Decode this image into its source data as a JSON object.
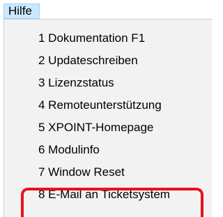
{
  "menubar": {
    "title": "Hilfe"
  },
  "menu": {
    "items": [
      {
        "label": "1 Dokumentation F1"
      },
      {
        "label": "2 Updateschreiben"
      },
      {
        "label": "3 Lizenzstatus"
      },
      {
        "label": "4 Remoteunterstützung"
      },
      {
        "label": "5 XPOINT-Homepage"
      },
      {
        "label": "6 Modulinfo"
      },
      {
        "label": "7 Window Reset"
      },
      {
        "label": "8 E-Mail an Ticketsystem"
      }
    ]
  },
  "colors": {
    "highlight": "#e8121b",
    "menu_title_bg": "#cce8ff",
    "menu_bg": "#f2f2f2"
  }
}
